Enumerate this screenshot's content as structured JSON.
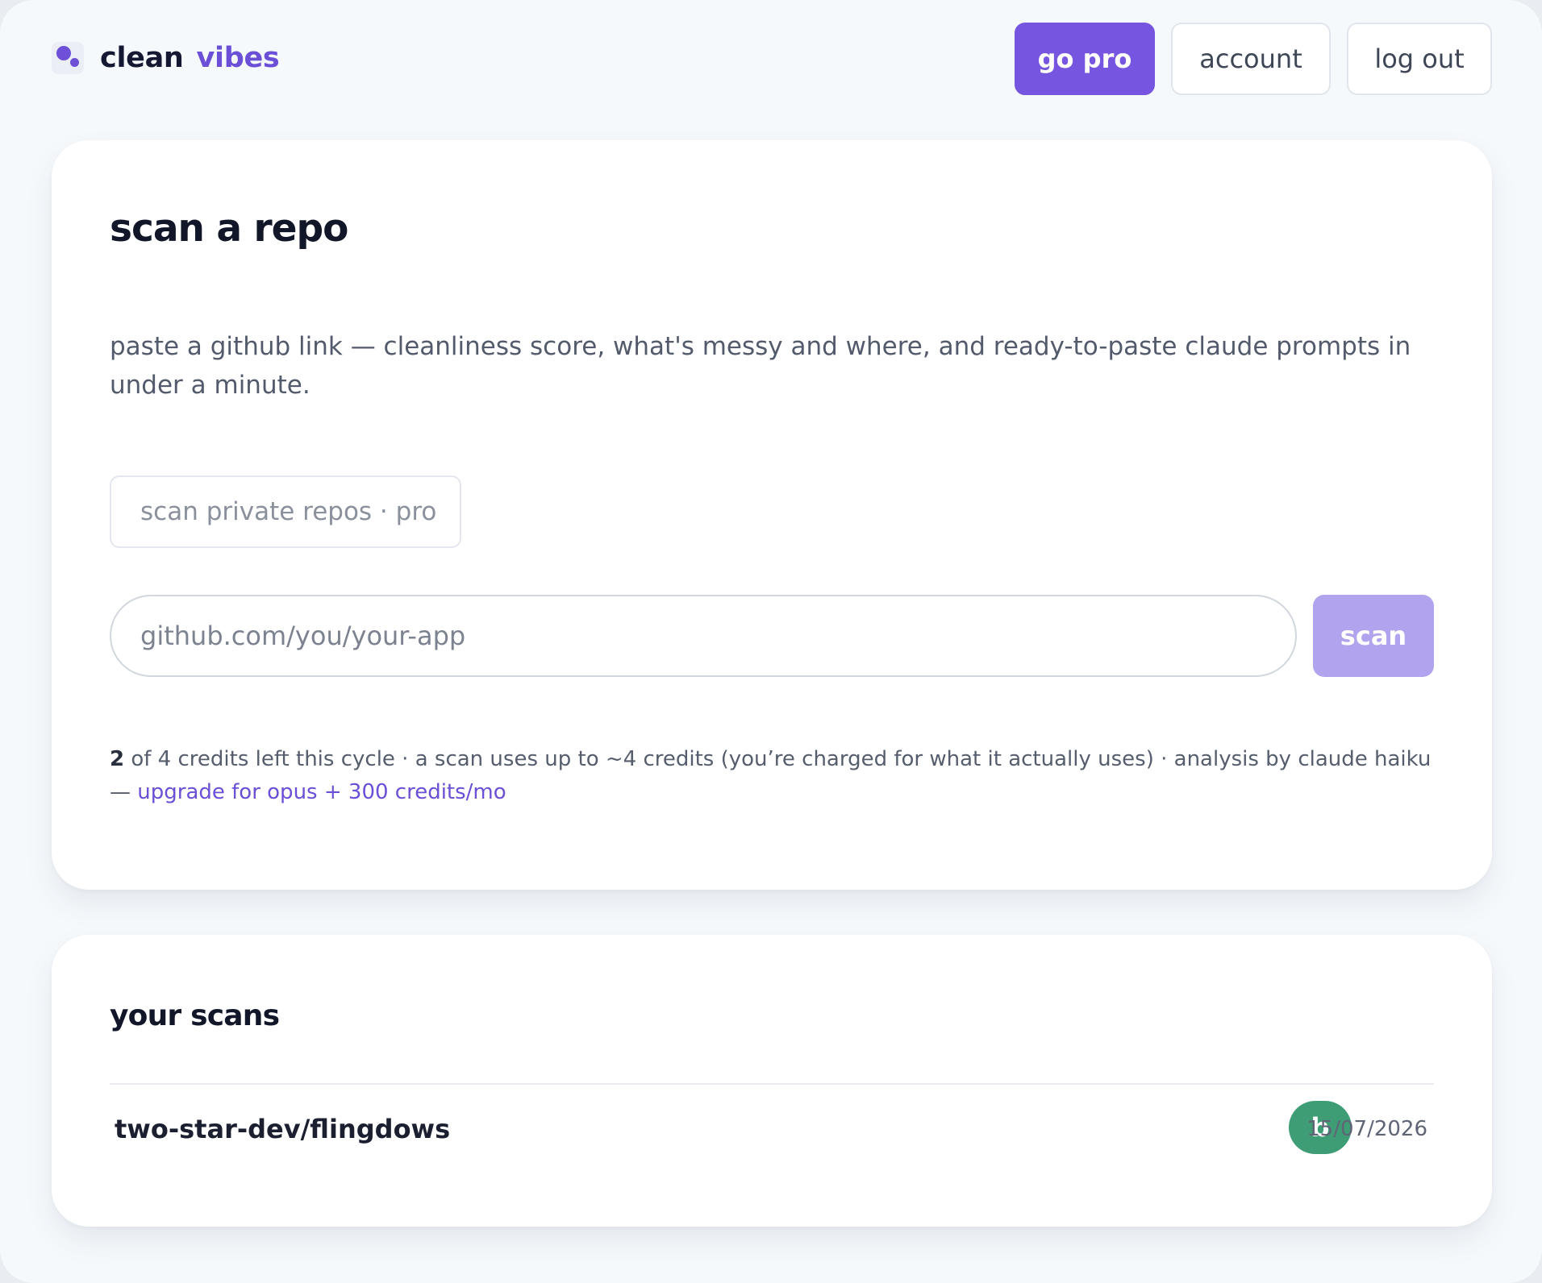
{
  "app": {
    "name": "clean",
    "name_accent": "vibes"
  },
  "header": {
    "go_pro_label": "go pro",
    "account_label": "account",
    "logout_label": "log out"
  },
  "scan_card": {
    "title": "scan a repo",
    "description": "paste a github link — cleanliness score, what's messy and where, and ready-to-paste claude prompts in under a minute.",
    "private_chip": "scan private repos · pro",
    "url_placeholder": "github.com/you/your-app",
    "url_value": "",
    "scan_label": "scan",
    "credits_left": "2",
    "credits_text": " of 4 credits left this cycle · a scan uses up to ~4 credits (you’re charged for what it actually uses) · analysis by claude haiku — ",
    "upgrade_link": "upgrade for opus + 300 credits/mo"
  },
  "scans_card": {
    "title": "your scans",
    "items": [
      {
        "repo": "two-star-dev/flingdows",
        "grade": "b",
        "date": "15/07/2026"
      }
    ]
  },
  "colors": {
    "accent": "#7656e0",
    "accent_disabled": "#b2a3ee",
    "grade_b": "#3f9d76",
    "background": "#f6f9fc"
  }
}
